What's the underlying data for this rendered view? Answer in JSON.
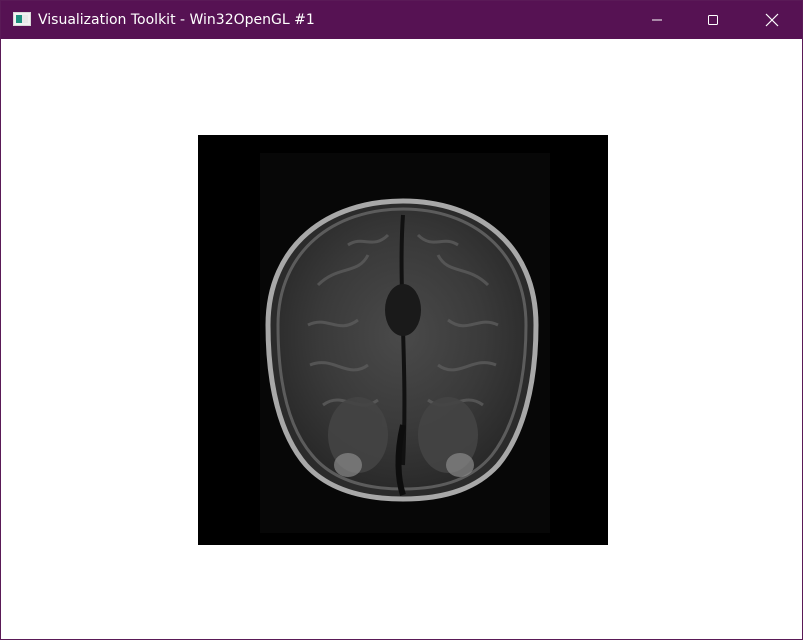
{
  "window": {
    "title": "Visualization Toolkit - Win32OpenGL #1",
    "icon": "vtk-window-icon",
    "titlebar_color": "#561253"
  },
  "controls": {
    "minimize": "minimize-icon",
    "maximize": "maximize-icon",
    "close": "close-icon"
  },
  "viewport": {
    "background": "#ffffff",
    "content": "mri-brain-axial-slice",
    "image_background": "#000000"
  }
}
